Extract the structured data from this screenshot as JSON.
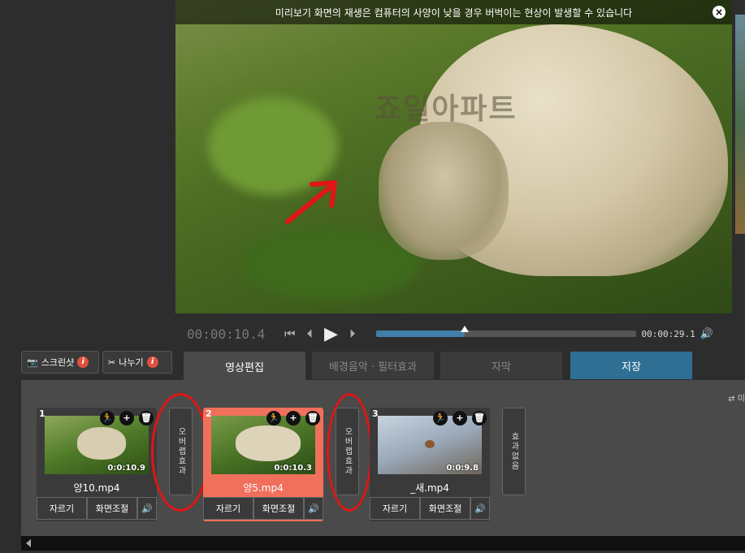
{
  "preview": {
    "notice": "미리보기 화면의 재생은 컴퓨터의 사양이 낮을 경우 버벅이는 현상이 발생할 수 있습니다",
    "close_icon": "×",
    "watermark": "죠일아파트"
  },
  "transport": {
    "current_time": "00:00:10.4",
    "total_time": "00:00:29.1",
    "progress": 0.34
  },
  "tools": {
    "screenshot_label": "스크린샷",
    "split_label": "나누기",
    "info": "i"
  },
  "tabs": [
    {
      "label": "영상편집"
    },
    {
      "label": "배경음악 · 필터효과"
    },
    {
      "label": "자막"
    },
    {
      "label": "저장"
    }
  ],
  "timeline": {
    "swap_label": "⇄ 미",
    "clips": [
      {
        "num": "1",
        "duration": "0:0:10.9",
        "name": "양10.mp4",
        "cut": "자르기",
        "adjust": "화면조절"
      },
      {
        "num": "2",
        "duration": "0:0:10.3",
        "name": "양5.mp4",
        "cut": "자르기",
        "adjust": "화면조절"
      },
      {
        "num": "3",
        "duration": "0:0:9.8",
        "name": "_새.mp4",
        "cut": "자르기",
        "adjust": "화면조절"
      }
    ],
    "transitions": [
      {
        "label": "오버랩효과"
      },
      {
        "label": "오버랩효과"
      },
      {
        "label": "효과없음"
      }
    ]
  },
  "colors": {
    "active_clip": "#f0705c",
    "save_tab": "#2f6f94",
    "progress": "#3f7fa8",
    "annotation": "#e01515"
  }
}
